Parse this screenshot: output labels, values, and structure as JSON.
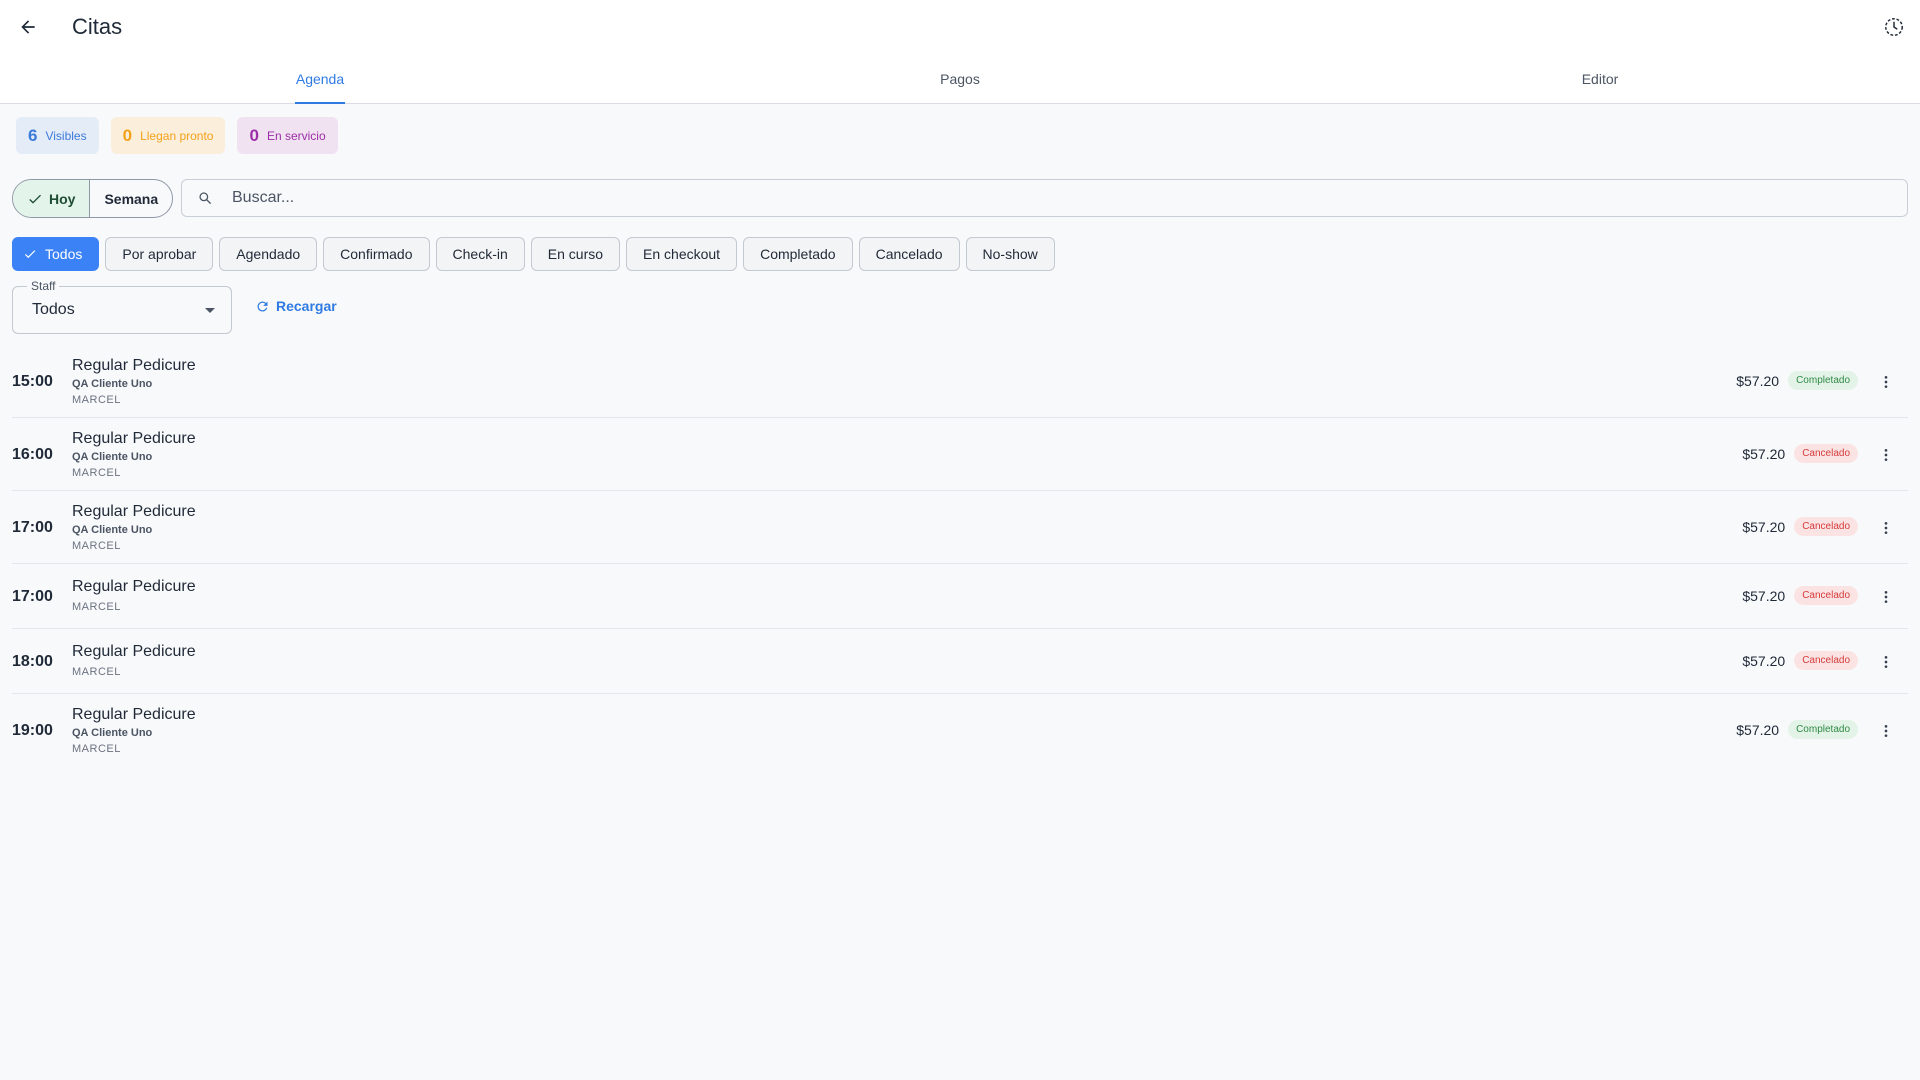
{
  "header": {
    "title": "Citas",
    "back_icon": "arrow-left-icon",
    "history_icon": "history-icon"
  },
  "tabs": [
    {
      "label": "Agenda",
      "active": true
    },
    {
      "label": "Pagos",
      "active": false
    },
    {
      "label": "Editor",
      "active": false
    }
  ],
  "counters": [
    {
      "value": "6",
      "label": "Visibles",
      "color": "#3b7ad9"
    },
    {
      "value": "0",
      "label": "Llegan pronto",
      "color": "#f2a21a"
    },
    {
      "value": "0",
      "label": "En servicio",
      "color": "#9c2fa7"
    }
  ],
  "range_toggle": {
    "day": "Hoy",
    "week": "Semana",
    "selected": "Hoy"
  },
  "search": {
    "placeholder": "Buscar...",
    "value": ""
  },
  "filters": [
    "Todos",
    "Por aprobar",
    "Agendado",
    "Confirmado",
    "Check-in",
    "En curso",
    "En checkout",
    "Completado",
    "Cancelado",
    "No-show"
  ],
  "active_filter": "Todos",
  "staff_select": {
    "legend": "Staff",
    "value": "Todos"
  },
  "reload_label": "Recargar",
  "appointments": [
    {
      "time": "15:00",
      "service": "Regular Pedicure",
      "client": "QA Cliente Uno",
      "staff": "MARCEL",
      "price": "$57.20",
      "status": "Completado"
    },
    {
      "time": "16:00",
      "service": "Regular Pedicure",
      "client": "QA Cliente Uno",
      "staff": "MARCEL",
      "price": "$57.20",
      "status": "Cancelado"
    },
    {
      "time": "17:00",
      "service": "Regular Pedicure",
      "client": "QA Cliente Uno",
      "staff": "MARCEL",
      "price": "$57.20",
      "status": "Cancelado"
    },
    {
      "time": "17:00",
      "service": "Regular Pedicure",
      "client": "",
      "staff": "MARCEL",
      "price": "$57.20",
      "status": "Cancelado"
    },
    {
      "time": "18:00",
      "service": "Regular Pedicure",
      "client": "",
      "staff": "MARCEL",
      "price": "$57.20",
      "status": "Cancelado"
    },
    {
      "time": "19:00",
      "service": "Regular Pedicure",
      "client": "QA Cliente Uno",
      "staff": "MARCEL",
      "price": "$57.20",
      "status": "Completado"
    }
  ],
  "colors": {
    "accent": "#2f7be3",
    "completed": "#2f8a45",
    "cancelled": "#d63b3b"
  }
}
